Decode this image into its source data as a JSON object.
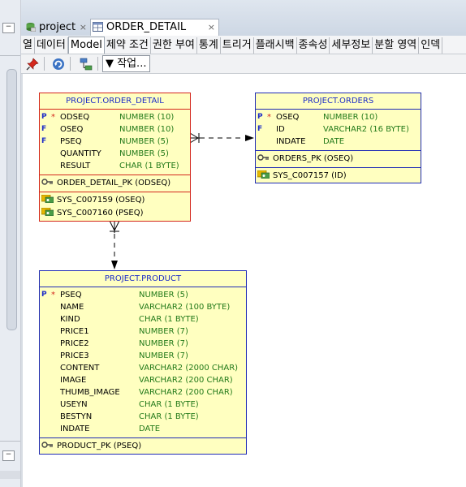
{
  "tabs": [
    {
      "label": "project",
      "close": "×"
    },
    {
      "label": "ORDER_DETAIL",
      "close": "×"
    }
  ],
  "subtabs": [
    "열",
    "데이터",
    "Model",
    "제약 조건",
    "권한 부여",
    "통계",
    "트리거",
    "플래시백",
    "종속성",
    "세부정보",
    "분할 영역",
    "인덱"
  ],
  "toolbar": {
    "action_label": "작업...",
    "action_arrow": "▼"
  },
  "entities": {
    "order_detail": {
      "title": "PROJECT.ORDER_DETAIL",
      "columns": [
        {
          "flag": "P",
          "star": "*",
          "name": "ODSEQ",
          "type": "NUMBER (10)"
        },
        {
          "flag": "F",
          "star": "",
          "name": "OSEQ",
          "type": "NUMBER (10)"
        },
        {
          "flag": "F",
          "star": "",
          "name": "PSEQ",
          "type": "NUMBER (5)"
        },
        {
          "flag": "",
          "star": "",
          "name": "QUANTITY",
          "type": "NUMBER (5)"
        },
        {
          "flag": "",
          "star": "",
          "name": "RESULT",
          "type": "CHAR (1 BYTE)"
        }
      ],
      "pk": "ORDER_DETAIL_PK (ODSEQ)",
      "constraints": [
        "SYS_C007159 (OSEQ)",
        "SYS_C007160 (PSEQ)"
      ]
    },
    "orders": {
      "title": "PROJECT.ORDERS",
      "columns": [
        {
          "flag": "P",
          "star": "*",
          "name": "OSEQ",
          "type": "NUMBER (10)"
        },
        {
          "flag": "F",
          "star": "",
          "name": "ID",
          "type": "VARCHAR2 (16 BYTE)"
        },
        {
          "flag": "",
          "star": "",
          "name": "INDATE",
          "type": "DATE"
        }
      ],
      "pk": "ORDERS_PK (OSEQ)",
      "constraints": [
        "SYS_C007157 (ID)"
      ]
    },
    "product": {
      "title": "PROJECT.PRODUCT",
      "columns": [
        {
          "flag": "P",
          "star": "*",
          "name": "PSEQ",
          "type": "NUMBER (5)"
        },
        {
          "flag": "",
          "star": "",
          "name": "NAME",
          "type": "VARCHAR2 (100 BYTE)"
        },
        {
          "flag": "",
          "star": "",
          "name": "KIND",
          "type": "CHAR (1 BYTE)"
        },
        {
          "flag": "",
          "star": "",
          "name": "PRICE1",
          "type": "NUMBER (7)"
        },
        {
          "flag": "",
          "star": "",
          "name": "PRICE2",
          "type": "NUMBER (7)"
        },
        {
          "flag": "",
          "star": "",
          "name": "PRICE3",
          "type": "NUMBER (7)"
        },
        {
          "flag": "",
          "star": "",
          "name": "CONTENT",
          "type": "VARCHAR2 (2000 CHAR)"
        },
        {
          "flag": "",
          "star": "",
          "name": "IMAGE",
          "type": "VARCHAR2 (200 CHAR)"
        },
        {
          "flag": "",
          "star": "",
          "name": "THUMB_IMAGE",
          "type": "VARCHAR2 (200 CHAR)"
        },
        {
          "flag": "",
          "star": "",
          "name": "USEYN",
          "type": "CHAR (1 BYTE)"
        },
        {
          "flag": "",
          "star": "",
          "name": "BESTYN",
          "type": "CHAR (1 BYTE)"
        },
        {
          "flag": "",
          "star": "",
          "name": "INDATE",
          "type": "DATE"
        }
      ],
      "pk": "PRODUCT_PK (PSEQ)",
      "constraints": []
    }
  },
  "colors": {
    "entity_fill": "#ffffc0",
    "fk_border": "#d4281d",
    "table_border": "#1f2bb5",
    "type_text": "#237a1a",
    "title_text": "#1d2dc7"
  }
}
